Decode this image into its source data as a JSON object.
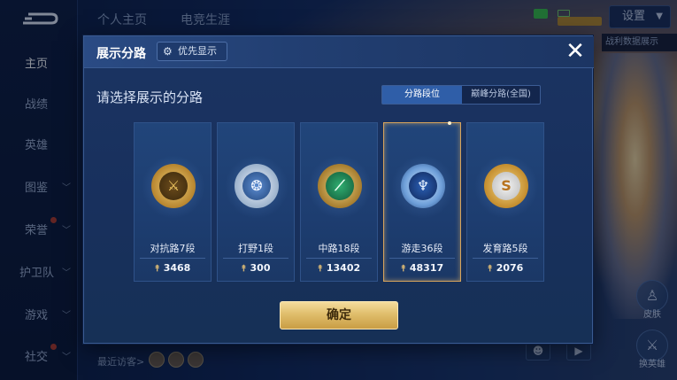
{
  "background": {
    "nav": [
      {
        "label": "主页",
        "active": true,
        "has_chevron": false,
        "dot": false
      },
      {
        "label": "战绩",
        "active": false,
        "has_chevron": false,
        "dot": false
      },
      {
        "label": "英雄",
        "active": false,
        "has_chevron": false,
        "dot": false
      },
      {
        "label": "图鉴",
        "active": false,
        "has_chevron": true,
        "dot": false
      },
      {
        "label": "荣誉",
        "active": false,
        "has_chevron": true,
        "dot": true
      },
      {
        "label": "护卫队",
        "active": false,
        "has_chevron": true,
        "dot": false
      },
      {
        "label": "游戏",
        "active": false,
        "has_chevron": true,
        "dot": false
      },
      {
        "label": "社交",
        "active": false,
        "has_chevron": true,
        "dot": true
      }
    ],
    "tabs": [
      "个人主页",
      "电竞生涯"
    ],
    "settings_label": "设置",
    "side_hint": "战利数据展示",
    "visitors_label": "最近访客>",
    "right_icons": [
      {
        "icon": "figure-icon",
        "label": "皮肤"
      },
      {
        "icon": "hero-icon",
        "label": "换英雄"
      }
    ]
  },
  "dialog": {
    "title": "展示分路",
    "priority_label": "优先显示",
    "close_symbol": "✕",
    "subtitle": "请选择展示的分路",
    "toggle": {
      "selected": "分路段位",
      "other": "巅峰分路(全国)"
    },
    "lanes": [
      {
        "label": "对抗路7段",
        "score": "3468",
        "emblem": "gold",
        "glyph": "⚔",
        "selected": false
      },
      {
        "label": "打野1段",
        "score": "300",
        "emblem": "silver",
        "glyph": "❂",
        "selected": false
      },
      {
        "label": "中路18段",
        "score": "13402",
        "emblem": "green",
        "glyph": "⟋",
        "selected": false
      },
      {
        "label": "游走36段",
        "score": "48317",
        "emblem": "blue",
        "glyph": "♆",
        "selected": true
      },
      {
        "label": "发育路5段",
        "score": "2076",
        "emblem": "orange",
        "glyph": "S",
        "selected": false
      }
    ],
    "score_icon": "⯭",
    "confirm_label": "确定"
  }
}
